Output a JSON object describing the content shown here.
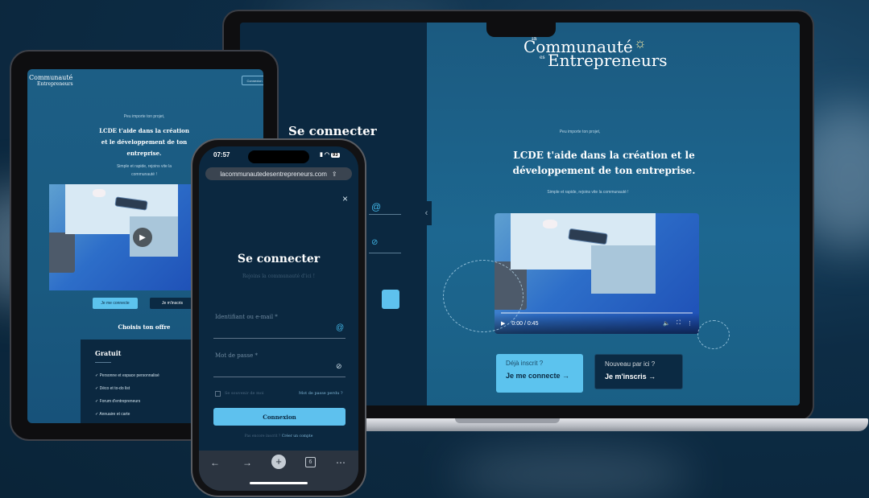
{
  "brand": {
    "logo_prefix": "la",
    "logo_line1": "Communauté",
    "logo_es": "es",
    "logo_line2": "Entrepreneurs",
    "logo_small": "Communauté",
    "logo_small_sub": "Entrepreneurs"
  },
  "laptop": {
    "login_title": "Se connecter",
    "tagline_small": "Peu importe ton projet,",
    "headline_line1": "LCDE t'aide dans la création et le",
    "headline_line2": "développement de ton entreprise.",
    "subline": "Simple et rapide, rejoins vite la communauté !",
    "video_time": "0:00 / 0:45",
    "cards": {
      "existing_small": "Déjà inscrit ?",
      "existing_bold": "Je me connecte →",
      "new_small": "Nouveau par ici ?",
      "new_bold": "Je m'inscris →"
    }
  },
  "tablet": {
    "header_button": "Connexion",
    "tagline_small": "Peu importe ton projet,",
    "headline_line1": "LCDE t'aide dans la création",
    "headline_line2": "et le développement de ton",
    "headline_line3": "entreprise.",
    "subline_1": "Simple et rapide, rejoins vite la",
    "subline_2": "communauté !",
    "btn_login": "Je me connecte",
    "btn_signup": "Je m'inscris",
    "offer_title": "Choisis ton offre",
    "plan_name": "Gratuit",
    "plan_features": [
      "Personne et espace personnalisé",
      "Déco et to-do list",
      "Forum d'entrepreneurs",
      "Annuaire et carte"
    ]
  },
  "phone": {
    "time": "07:57",
    "battery": "93",
    "url": "lacommunautedesentrepreneurs.com",
    "title": "Se connecter",
    "subtitle": "Rejoins la communauté d'ici !",
    "email_label": "Identifiant ou e-mail *",
    "password_label": "Mot de passe *",
    "remember": "Se souvenir de moi",
    "forgot": "Mot de passe perdu ?",
    "submit": "Connexion",
    "register_prompt": "Pas encore inscrit ?",
    "register_link": "Créer un compte",
    "tab_count": "6"
  }
}
